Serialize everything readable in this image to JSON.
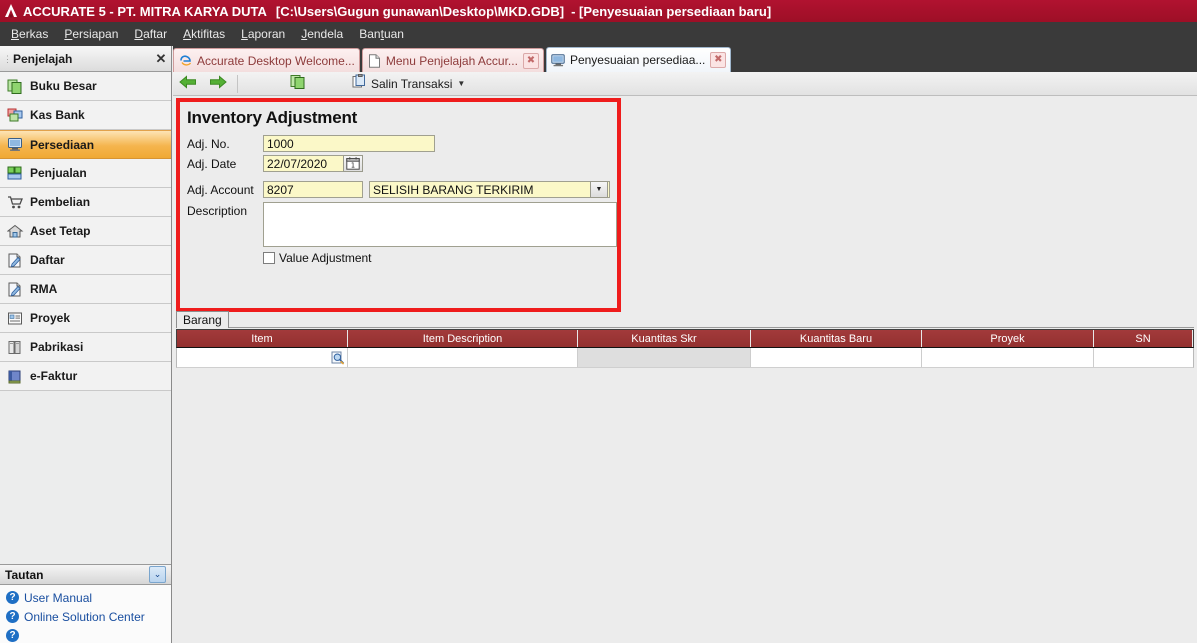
{
  "titlebar": {
    "logo_icon": "accurate-logo-icon",
    "app": "ACCURATE 5  - PT. MITRA KARYA DUTA",
    "path": "[C:\\Users\\Gugun gunawan\\Desktop\\MKD.GDB]",
    "document": "- [Penyesuaian persediaan baru]"
  },
  "menubar": {
    "items": [
      {
        "label": "Berkas",
        "accel": "B"
      },
      {
        "label": "Persiapan",
        "accel": "P"
      },
      {
        "label": "Daftar",
        "accel": "D"
      },
      {
        "label": "Aktifitas",
        "accel": "A"
      },
      {
        "label": "Laporan",
        "accel": "L"
      },
      {
        "label": "Jendela",
        "accel": "J"
      },
      {
        "label": "Bantuan",
        "accel": "t"
      }
    ]
  },
  "sidebar": {
    "title": "Penjelajah",
    "close_label": "✕",
    "items": [
      {
        "label": "Buku Besar",
        "icon": "documents-icon",
        "active": false
      },
      {
        "label": "Kas Bank",
        "icon": "windows-icon",
        "active": false
      },
      {
        "label": "Persediaan",
        "icon": "monitor-icon",
        "active": true
      },
      {
        "label": "Penjualan",
        "icon": "puzzle-icon",
        "active": false
      },
      {
        "label": "Pembelian",
        "icon": "cart-icon",
        "active": false
      },
      {
        "label": "Aset Tetap",
        "icon": "house-icon",
        "active": false
      },
      {
        "label": "Daftar",
        "icon": "page-pencil-icon",
        "active": false
      },
      {
        "label": "RMA",
        "icon": "page-pencil-icon",
        "active": false
      },
      {
        "label": "Proyek",
        "icon": "list-box-icon",
        "active": false
      },
      {
        "label": "Pabrikasi",
        "icon": "books-icon",
        "active": false
      },
      {
        "label": "e-Faktur",
        "icon": "book-icon",
        "active": false
      }
    ],
    "links_section": {
      "title": "Tautan",
      "collapse_icon": "chevron-double-down-icon",
      "links": [
        {
          "label": "User Manual",
          "icon": "help-circle-icon"
        },
        {
          "label": "Online Solution Center",
          "icon": "help-circle-icon"
        }
      ]
    }
  },
  "tabs": [
    {
      "label": "Accurate Desktop Welcome...",
      "icon": "explorer-e-icon",
      "active": false,
      "closable": false
    },
    {
      "label": "Menu Penjelajah Accur...",
      "icon": "page-icon",
      "active": false,
      "closable": true
    },
    {
      "label": "Penyesuaian persediaa...",
      "icon": "monitor-icon",
      "active": true,
      "closable": true
    }
  ],
  "tab_close_label": "✖",
  "toolbar": {
    "back_icon": "arrow-left-icon",
    "forward_icon": "arrow-right-icon",
    "copy_icon": "copy-pages-icon",
    "salin_icon": "copy-transaction-icon",
    "salin_label": "Salin Transaksi",
    "dropdown_caret": "▼"
  },
  "form": {
    "title": "Inventory Adjustment",
    "adj_no": {
      "label": "Adj. No.",
      "value": "1000"
    },
    "adj_date": {
      "label": "Adj. Date",
      "value": "22/07/2020",
      "picker_icon": "calendar-icon"
    },
    "adj_account": {
      "label": "Adj. Account",
      "code": "8207",
      "name": "SELISIH BARANG TERKIRIM",
      "caret": "▼"
    },
    "description": {
      "label": "Description",
      "value": "",
      "placeholder": ""
    },
    "value_adjustment": {
      "label": "Value Adjustment",
      "checked": false
    }
  },
  "detail_tabs": [
    {
      "label": "Barang",
      "active": true
    }
  ],
  "grid": {
    "columns": [
      {
        "label": "Item",
        "key": "col-item"
      },
      {
        "label": "Item Description",
        "key": "col-desc"
      },
      {
        "label": "Kuantitas Skr",
        "key": "col-qskr"
      },
      {
        "label": "Kuantitas Baru",
        "key": "col-qbaru"
      },
      {
        "label": "Proyek",
        "key": "col-proyek"
      },
      {
        "label": "SN",
        "key": "col-sn"
      }
    ],
    "rows": [
      {
        "item": "",
        "desc": "",
        "qskr": "",
        "qbaru": "",
        "proyek": "",
        "sn": "",
        "item_lookup_icon": "magnifier-lookup-icon"
      }
    ]
  },
  "colors": {
    "title_red": "#a8122b",
    "grid_header_red": "#9b3334",
    "highlight_box_red": "#ef1c1c",
    "field_yellow": "#fbf8c8",
    "active_nav_orange": "#f0a934",
    "link_blue": "#1a4fa0"
  }
}
